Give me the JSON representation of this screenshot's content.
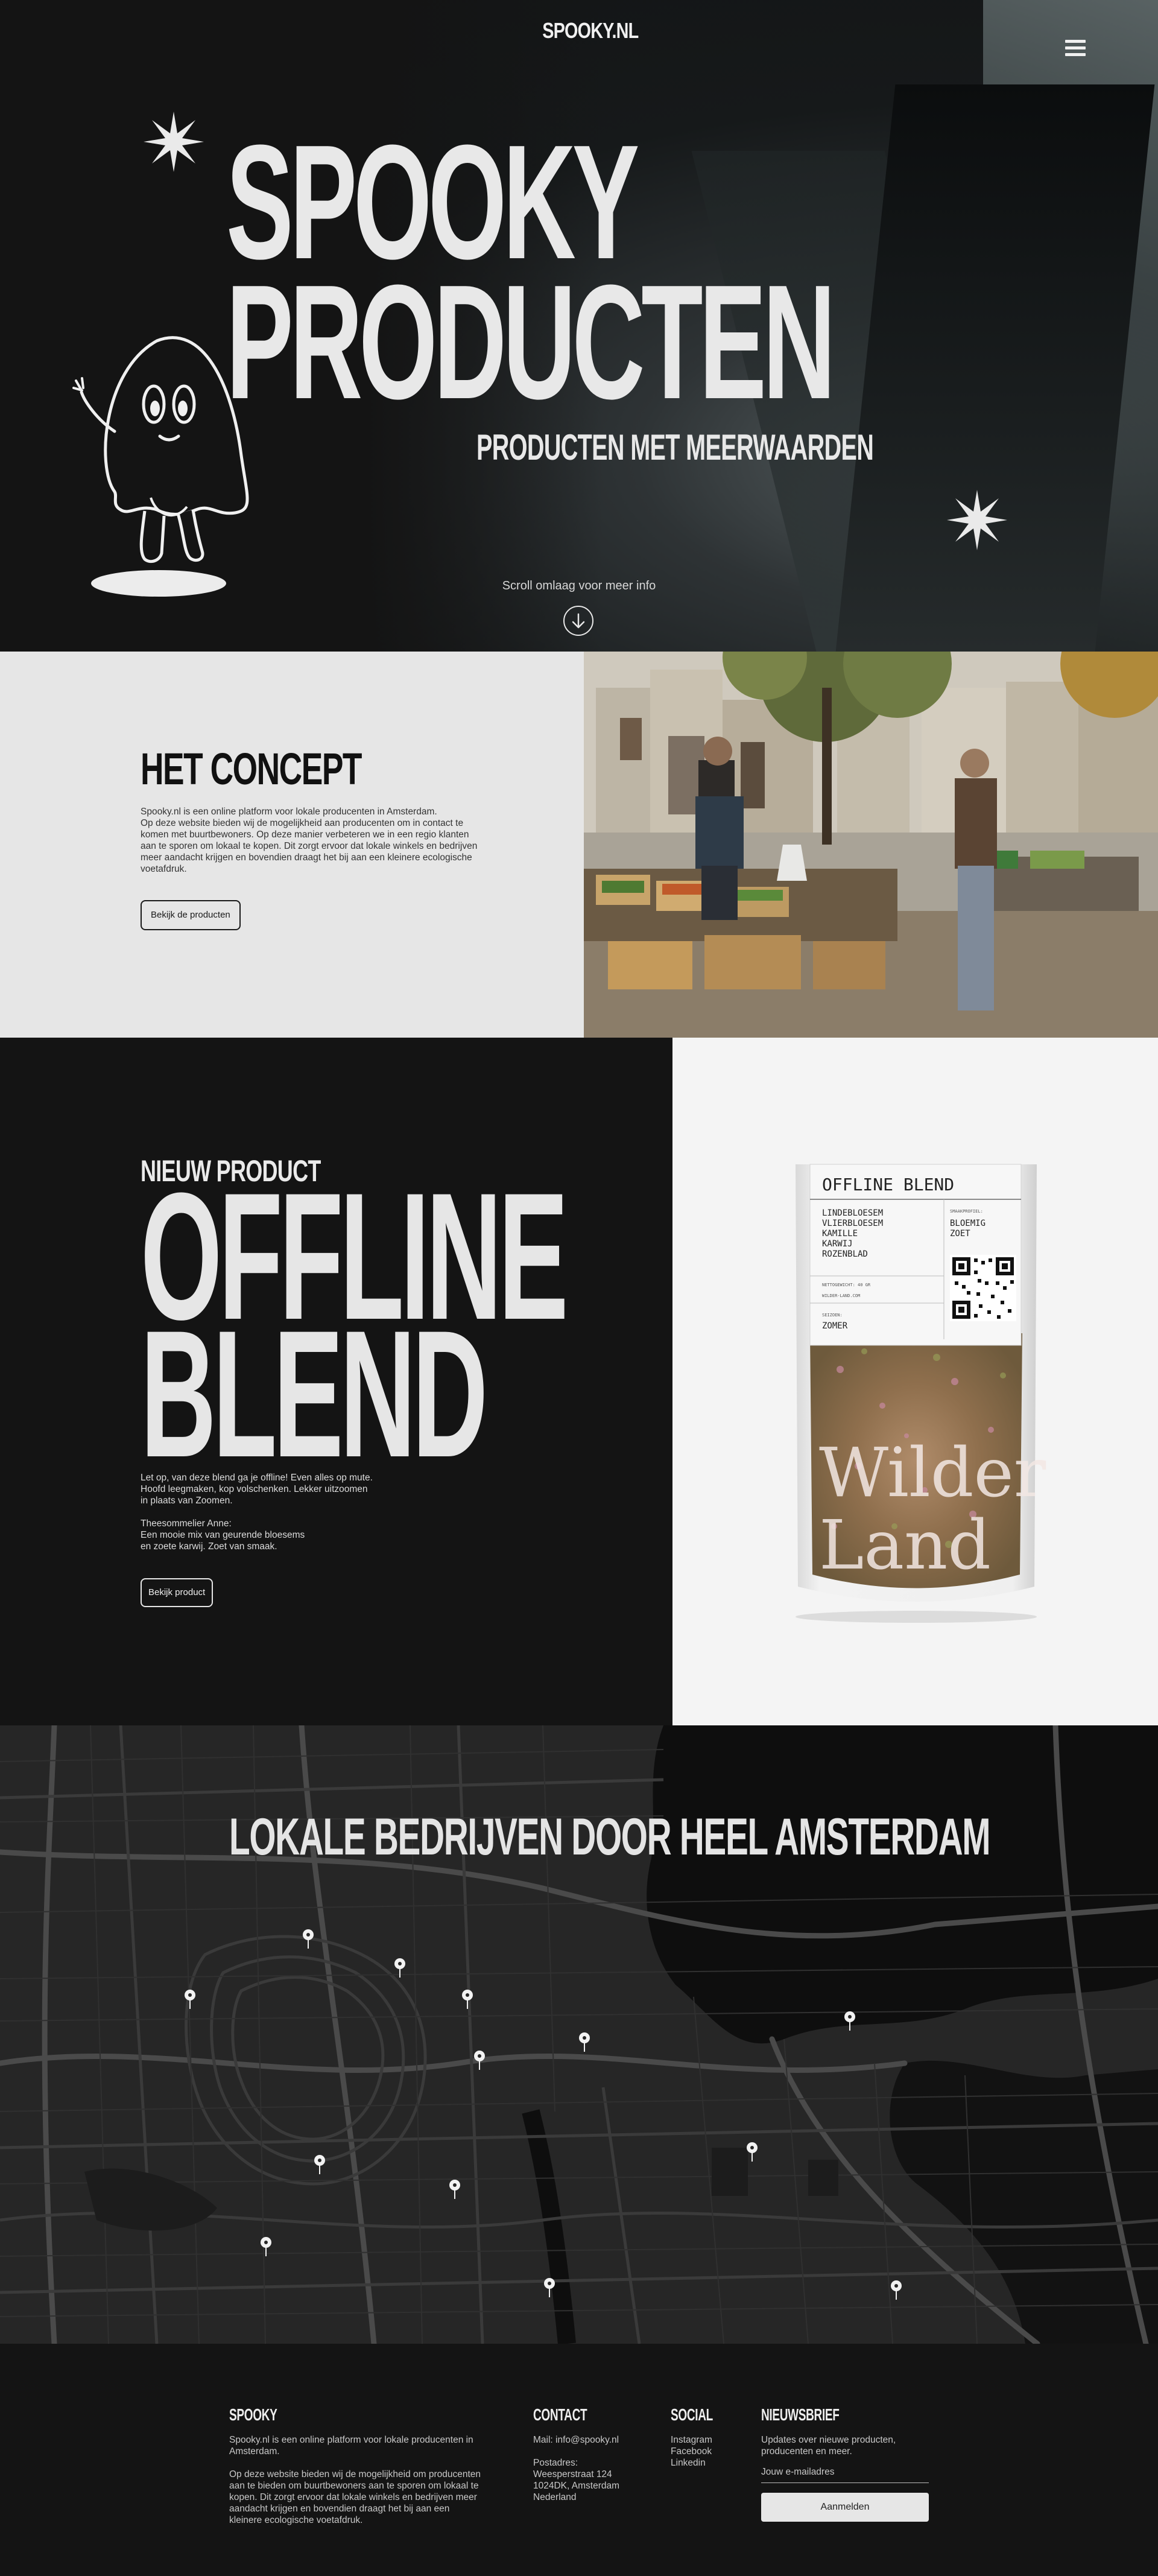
{
  "header": {
    "logo": "SPOOKY.NL",
    "menu_icon": "hamburger-menu-icon"
  },
  "hero": {
    "title_line1": "SPOOKY",
    "title_line2": "PRODUCTEN",
    "subtitle": "PRODUCTEN MET MEERWAARDEN",
    "scroll_text": "Scroll omlaag voor meer info",
    "scroll_icon": "arrow-down-circle-icon"
  },
  "concept": {
    "heading": "HET CONCEPT",
    "body_lines": [
      "Spooky.nl is een online platform voor lokale producenten in Amsterdam.",
      "Op deze website bieden wij de mogelijkheid aan producenten om in contact te",
      "komen met buurtbewoners. Op deze manier verbeteren we in een regio klanten",
      "aan te sporen om lokaal te kopen. Dit zorgt ervoor dat lokale winkels en bedrijven",
      "meer aandacht krijgen en bovendien draagt het bij aan een kleinere ecologische",
      "voetafdruk."
    ],
    "button": "Bekijk de producten"
  },
  "new_product": {
    "kicker": "NIEUW PRODUCT",
    "title_line1": "OFFLINE",
    "title_line2": "BLEND",
    "desc_lines": [
      "Let op, van deze blend ga je offline! Even alles op mute.",
      "Hoofd leegmaken, kop volschenken. Lekker uitzoomen",
      "in plaats van Zoomen."
    ],
    "quote_lines": [
      "Theesommelier Anne:",
      "Een mooie mix van geurende bloesems",
      "en zoete karwij. Zoet van smaak."
    ],
    "button": "Bekijk product",
    "bag": {
      "label_title": "OFFLINE BLEND",
      "ingredients": [
        "LINDEBLOESEM",
        "VLIERBLOESEM",
        "KAMILLE",
        "KARWIJ",
        "ROZENBLAD"
      ],
      "smaak_label": "SMAAKPROFIEL:",
      "smaak": [
        "BLOEMIG",
        "ZOET"
      ],
      "netto": "NETTOGEWICHT: 40 GR",
      "brand_small": "WILDER-LAND.COM",
      "seizoen_label": "SEIZOEN:",
      "seizoen": "ZOMER",
      "script_line1": "Wilder",
      "script_line2": "Land"
    }
  },
  "map": {
    "heading": "LOKALE BEDRIJVEN DOOR HEEL AMSTERDAM",
    "pin_icon": "map-pin-icon"
  },
  "footer": {
    "about_title": "SPOOKY",
    "about_lines1": [
      "Spooky.nl is een online platform voor lokale producenten in",
      "Amsterdam."
    ],
    "about_lines2": [
      "Op deze website bieden wij de mogelijkheid om producenten",
      "aan te bieden om buurtbewoners aan te sporen om lokaal te",
      "kopen. Dit zorgt ervoor dat lokale winkels en bedrijven meer",
      "aandacht krijgen en bovendien draagt het bij aan een",
      "kleinere ecologische voetafdruk."
    ],
    "contact_title": "CONTACT",
    "contact_mail": "Mail: info@spooky.nl",
    "contact_address": [
      "Postadres:",
      "Weesperstraat 124",
      "1024DK, Amsterdam",
      "Nederland"
    ],
    "social_title": "SOCIAL",
    "social_links": [
      "Instagram",
      "Facebook",
      "Linkedin"
    ],
    "news_title": "NIEUWSBRIEF",
    "news_text": [
      "Updates over nieuwe producten,",
      "producenten en meer."
    ],
    "news_placeholder": "Jouw e-mailadres",
    "news_button": "Aanmelden"
  },
  "colors": {
    "dark": "#141414",
    "light": "#e6e6e6",
    "white": "#f4f4f4"
  }
}
